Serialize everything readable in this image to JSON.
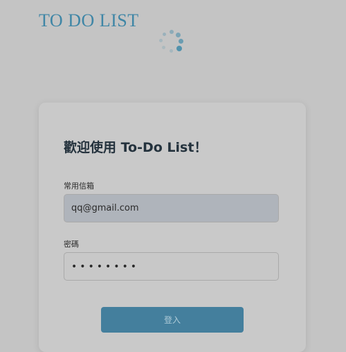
{
  "header": {
    "logo": "TO DO LIST"
  },
  "loading_indicator": {
    "icon": "spinner-icon"
  },
  "login": {
    "title": "歡迎使用 To-Do List！",
    "email_label": "常用信箱",
    "email_value": "qq@gmail.com",
    "password_label": "密碼",
    "password_value": "••••••••",
    "submit_label": "登入"
  },
  "colors": {
    "accent": "#3f86a6",
    "button": "#447f9d",
    "overlay": "#c4c4c4"
  }
}
